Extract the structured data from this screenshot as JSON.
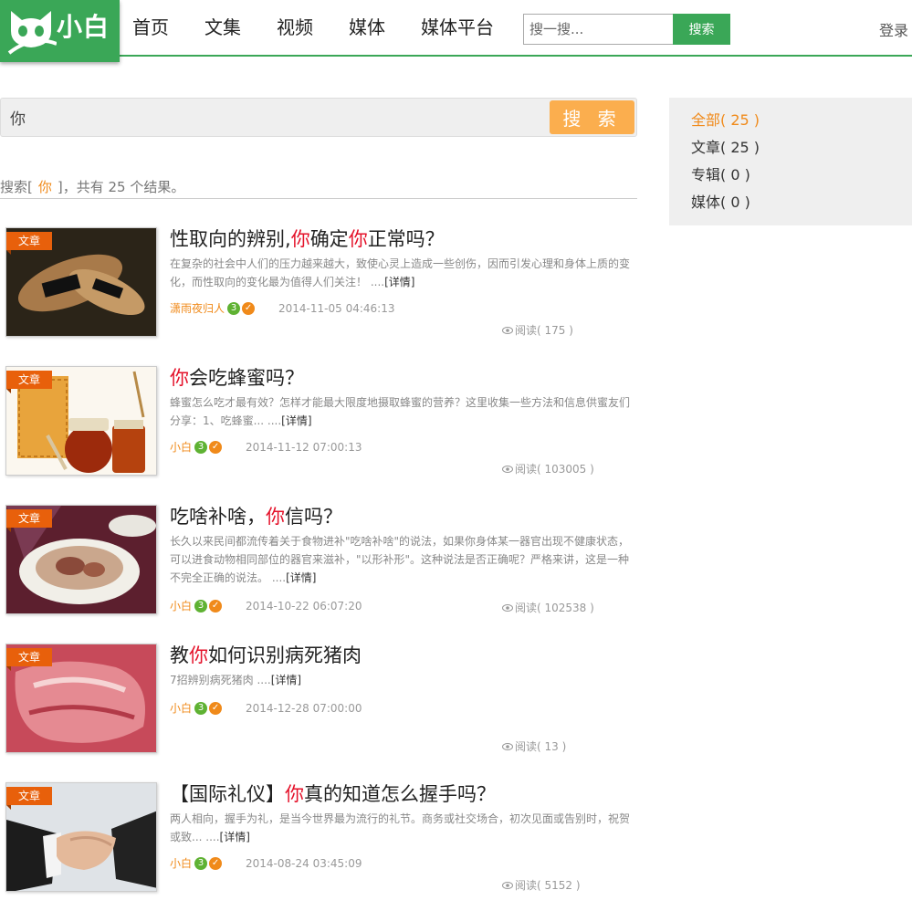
{
  "header": {
    "logo_text": "小白",
    "nav": [
      "首页",
      "文集",
      "视频",
      "媒体",
      "媒体平台"
    ],
    "search_placeholder": "搜一搜...",
    "search_button": "搜索",
    "login": "登录"
  },
  "search": {
    "query": "你",
    "button": "搜 索",
    "result_prefix": "搜索[",
    "result_keyword": "你",
    "result_suffix": "]，共有 25 个结果。"
  },
  "side": {
    "items": [
      "全部( 25 )",
      "文章( 25 )",
      "专辑( 0 )",
      "媒体( 0 )"
    ]
  },
  "articles": [
    {
      "tag": "文章",
      "title_parts": [
        "性取向的辨别,",
        "你",
        "确定",
        "你",
        "正常吗？"
      ],
      "summary": "在复杂的社会中人们的压力越来越大，致使心灵上造成一些创伤，因而引发心理和身体上质的变化，而性取向的变化最为值得人们关注！ ....",
      "more": "[详情]",
      "author": "潇雨夜归人",
      "level": "3",
      "date": "2014-11-05 04:46:13",
      "reads": "阅读( 175 )"
    },
    {
      "tag": "文章",
      "title_parts": [
        "",
        "你",
        "会吃蜂蜜吗？"
      ],
      "summary": "蜂蜜怎么吃才最有效？怎样才能最大限度地摄取蜂蜜的营养？这里收集一些方法和信息供蜜友们分享：1、吃蜂蜜... ....",
      "more": "[详情]",
      "author": "小白",
      "level": "3",
      "date": "2014-11-12 07:00:13",
      "reads": "阅读( 103005 )"
    },
    {
      "tag": "文章",
      "title_parts": [
        "吃啥补啥，",
        "你",
        "信吗？"
      ],
      "summary": "长久以来民间都流传着关于食物进补\"吃啥补啥\"的说法，如果你身体某一器官出现不健康状态，可以进食动物相同部位的器官来滋补，\"以形补形\"。这种说法是否正确呢？严格来讲，这是一种不完全正确的说法。 ....",
      "more": "[详情]",
      "author": "小白",
      "level": "3",
      "date": "2014-10-22 06:07:20",
      "reads": "阅读( 102538 )"
    },
    {
      "tag": "文章",
      "title_parts": [
        "教",
        "你",
        "如何识别病死猪肉"
      ],
      "summary": "7招辨别病死猪肉 ....",
      "more": "[详情]",
      "author": "小白",
      "level": "3",
      "date": "2014-12-28 07:00:00",
      "reads": "阅读( 13 )"
    },
    {
      "tag": "文章",
      "title_parts": [
        "【国际礼仪】",
        "你",
        "真的知道怎么握手吗？"
      ],
      "summary": " 两人相向，握手为礼，是当今世界最为流行的礼节。商务或社交场合，初次见面或告别时，祝贺或致... ....",
      "more": "[详情]",
      "author": "小白",
      "level": "3",
      "date": "2014-08-24 03:45:09",
      "reads": "阅读( 5152 )"
    }
  ]
}
